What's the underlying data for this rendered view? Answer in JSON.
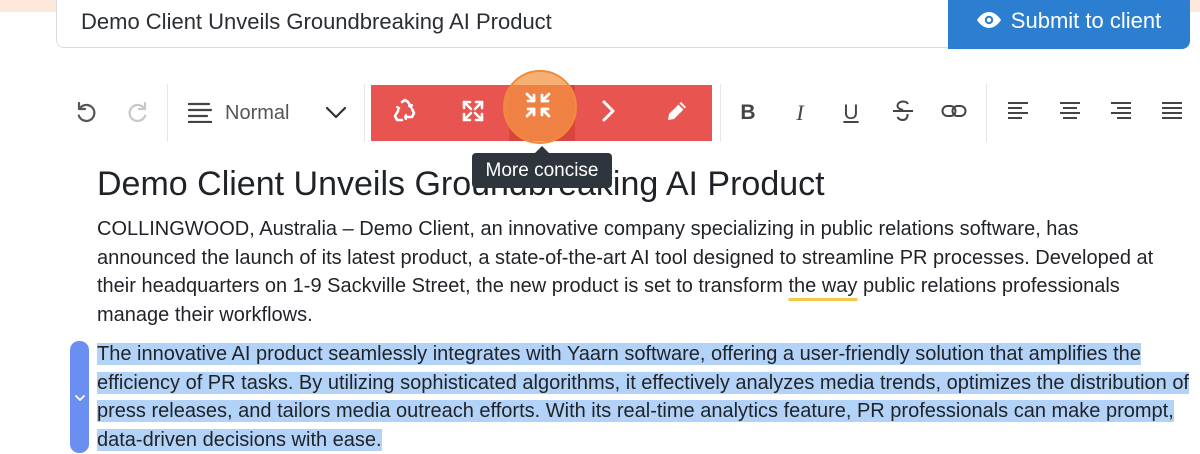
{
  "header": {
    "title_value": "Demo Client Unveils Groundbreaking AI Product",
    "submit_label": "Submit to client"
  },
  "toolbar": {
    "undo_icon": "undo-icon",
    "redo_icon": "redo-icon",
    "text_style": "Normal",
    "ai_actions": [
      "rephrase-icon",
      "expand-icon",
      "more-concise-icon",
      "continue-icon",
      "edit-icon"
    ],
    "format": [
      "bold",
      "italic",
      "underline",
      "strikethrough",
      "link",
      "align-left",
      "align-center",
      "align-right",
      "justify"
    ],
    "format_labels": {
      "bold": "B",
      "italic": "I",
      "underline": "U"
    },
    "tooltip": "More concise"
  },
  "document": {
    "heading": "Demo Client Unveils Groundbreaking AI Product",
    "p1_before": "COLLINGWOOD, Australia – Demo Client, an innovative company specializing in public relations software, has announced the launch of its latest product, a state-of-the-art AI tool designed to streamline PR processes. Developed at their headquarters on 1-9 Sackville Street, the new product is set to transform ",
    "p1_flagged": "the way",
    "p1_after": " public relations professionals manage their workflows.",
    "p2": "The innovative AI product seamlessly integrates with Yaarn software, offering a user-friendly solution that amplifies the efficiency of PR tasks. By utilizing sophisticated algorithms, it effectively analyzes media trends, optimizes the distribution of press releases, and tailors media outreach efforts. With its real-time analytics feature, PR professionals can make prompt, data-driven decisions with ease."
  },
  "colors": {
    "accent_blue": "#2c7fd0",
    "ai_bar_red": "#e8544f",
    "selection": "#b3d2f7",
    "highlight_orange": "#f49646"
  }
}
